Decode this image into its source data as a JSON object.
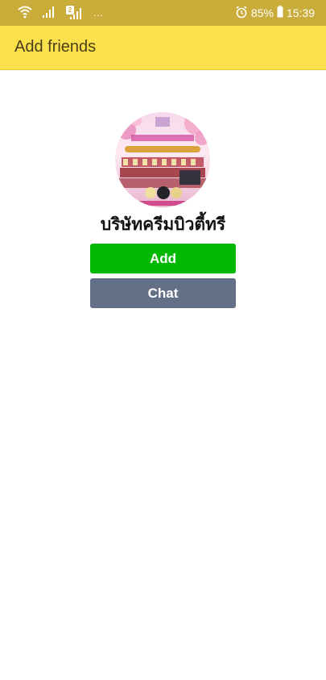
{
  "status_bar": {
    "battery": "85%",
    "time": "15:39",
    "sim_badge": "2",
    "overflow": "...",
    "icons": [
      "wifi-icon",
      "signal-icon",
      "signal-icon",
      "alarm-icon",
      "battery-icon"
    ]
  },
  "header": {
    "title": "Add friends"
  },
  "profile": {
    "name": "บริษัทครีมบิวตี้ทรี",
    "avatar_icon": "brand-avatar-image"
  },
  "actions": {
    "add_label": "Add",
    "chat_label": "Chat"
  },
  "colors": {
    "status_bar": "#c9ac3a",
    "header": "#fde14b",
    "add_button": "#00b900",
    "chat_button": "#646f88"
  }
}
